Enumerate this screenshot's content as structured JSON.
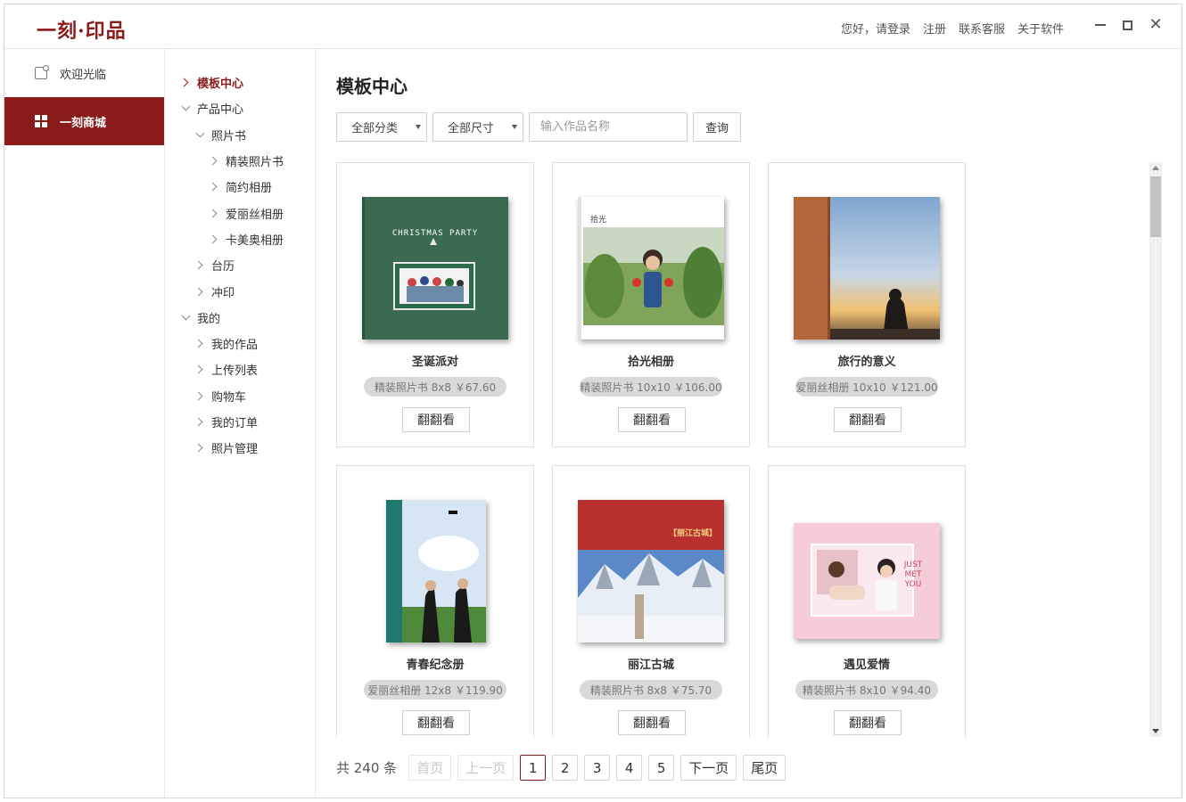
{
  "app": {
    "logo": "一刻·印品",
    "accent": "#8b1a1a"
  },
  "header": {
    "links": [
      "您好，请登录",
      "注册",
      "联系客服",
      "关于软件"
    ]
  },
  "sidebar": {
    "items": [
      {
        "label": "欢迎光临",
        "icon": "note-icon",
        "active": false
      },
      {
        "label": "一刻商城",
        "icon": "grid-icon",
        "active": true
      }
    ]
  },
  "tree": {
    "items": [
      {
        "label": "模板中心",
        "level": 0,
        "expanded": false,
        "active": true
      },
      {
        "label": "产品中心",
        "level": 0,
        "expanded": true,
        "active": false
      },
      {
        "label": "照片书",
        "level": 1,
        "expanded": true,
        "active": false
      },
      {
        "label": "精装照片书",
        "level": 2,
        "expanded": false,
        "active": false
      },
      {
        "label": "简约相册",
        "level": 2,
        "expanded": false,
        "active": false
      },
      {
        "label": "爱丽丝相册",
        "level": 2,
        "expanded": false,
        "active": false
      },
      {
        "label": "卡美奥相册",
        "level": 2,
        "expanded": false,
        "active": false
      },
      {
        "label": "台历",
        "level": 1,
        "expanded": false,
        "active": false
      },
      {
        "label": "冲印",
        "level": 1,
        "expanded": false,
        "active": false
      },
      {
        "label": "我的",
        "level": 0,
        "expanded": true,
        "active": false
      },
      {
        "label": "我的作品",
        "level": 1,
        "expanded": false,
        "active": false
      },
      {
        "label": "上传列表",
        "level": 1,
        "expanded": false,
        "active": false
      },
      {
        "label": "购物车",
        "level": 1,
        "expanded": false,
        "active": false
      },
      {
        "label": "我的订单",
        "level": 1,
        "expanded": false,
        "active": false
      },
      {
        "label": "照片管理",
        "level": 1,
        "expanded": false,
        "active": false
      }
    ]
  },
  "main": {
    "title": "模板中心",
    "filters": {
      "category": "全部分类",
      "size": "全部尺寸",
      "search_placeholder": "输入作品名称",
      "query_label": "查询"
    },
    "flip_label": "翻翻看",
    "cards": [
      {
        "title": "圣诞派对",
        "price": "精装照片书 8x8 ￥67.60",
        "cover_text": "CHRISTMAS PARTY"
      },
      {
        "title": "拾光相册",
        "price": "精装照片书 10x10 ￥106.00",
        "cover_text": "拾光"
      },
      {
        "title": "旅行的意义",
        "price": "爱丽丝相册 10x10 ￥121.00",
        "cover_text": ""
      },
      {
        "title": "青春纪念册",
        "price": "爱丽丝相册 12x8 ￥119.90",
        "cover_text": ""
      },
      {
        "title": "丽江古城",
        "price": "精装照片书 8x8 ￥75.70",
        "cover_text": "【丽江古城】"
      },
      {
        "title": "遇见爱情",
        "price": "精装照片书 8x10 ￥94.40",
        "cover_text": "JUST MET YOU"
      }
    ]
  },
  "pagination": {
    "total": "共 240 条",
    "first": "首页",
    "prev": "上一页",
    "pages": [
      "1",
      "2",
      "3",
      "4",
      "5"
    ],
    "current": "1",
    "next": "下一页",
    "last": "尾页"
  }
}
